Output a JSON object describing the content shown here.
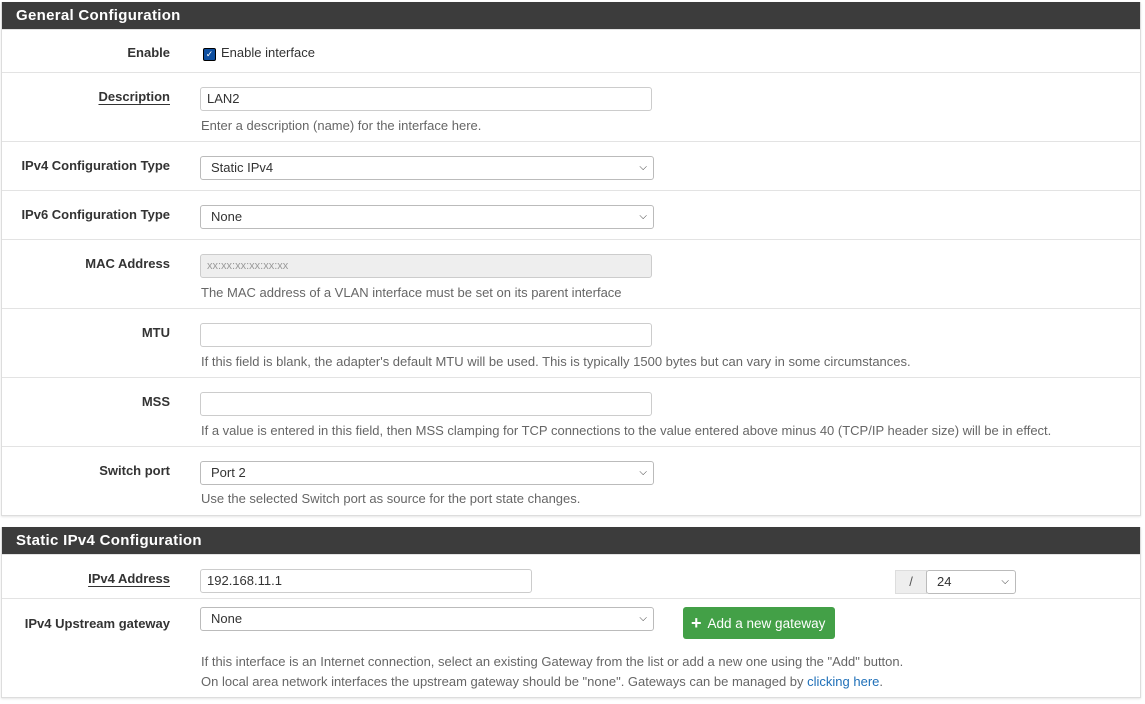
{
  "general": {
    "title": "General Configuration",
    "enable": {
      "label": "Enable",
      "checkbox_label": "Enable interface",
      "checked": true
    },
    "description": {
      "label": "Description",
      "value": "LAN2",
      "help": "Enter a description (name) for the interface here."
    },
    "ipv4_type": {
      "label": "IPv4 Configuration Type",
      "value": "Static IPv4"
    },
    "ipv6_type": {
      "label": "IPv6 Configuration Type",
      "value": "None"
    },
    "mac": {
      "label": "MAC Address",
      "placeholder": "xx:xx:xx:xx:xx:xx",
      "help": "The MAC address of a VLAN interface must be set on its parent interface"
    },
    "mtu": {
      "label": "MTU",
      "value": "",
      "help": "If this field is blank, the adapter's default MTU will be used. This is typically 1500 bytes but can vary in some circumstances."
    },
    "mss": {
      "label": "MSS",
      "value": "",
      "help": "If a value is entered in this field, then MSS clamping for TCP connections to the value entered above minus 40 (TCP/IP header size) will be in effect."
    },
    "switch_port": {
      "label": "Switch port",
      "value": "Port 2",
      "help": "Use the selected Switch port as source for the port state changes."
    }
  },
  "static": {
    "title": "Static IPv4 Configuration",
    "address": {
      "label": "IPv4 Address",
      "value": "192.168.11.1",
      "slash": "/",
      "cidr": "24"
    },
    "gateway": {
      "label": "IPv4 Upstream gateway",
      "value": "None",
      "add_button": "Add a new gateway",
      "help1": "If this interface is an Internet connection, select an existing Gateway from the list or add a new one using the \"Add\" button.",
      "help2_prefix": "On local area network interfaces the upstream gateway should be \"none\". Gateways can be managed by ",
      "help2_link": "clicking here",
      "help2_suffix": "."
    }
  },
  "colors": {
    "header": "#3c3c3c",
    "button": "#43a047",
    "link": "#1e6fb8"
  }
}
